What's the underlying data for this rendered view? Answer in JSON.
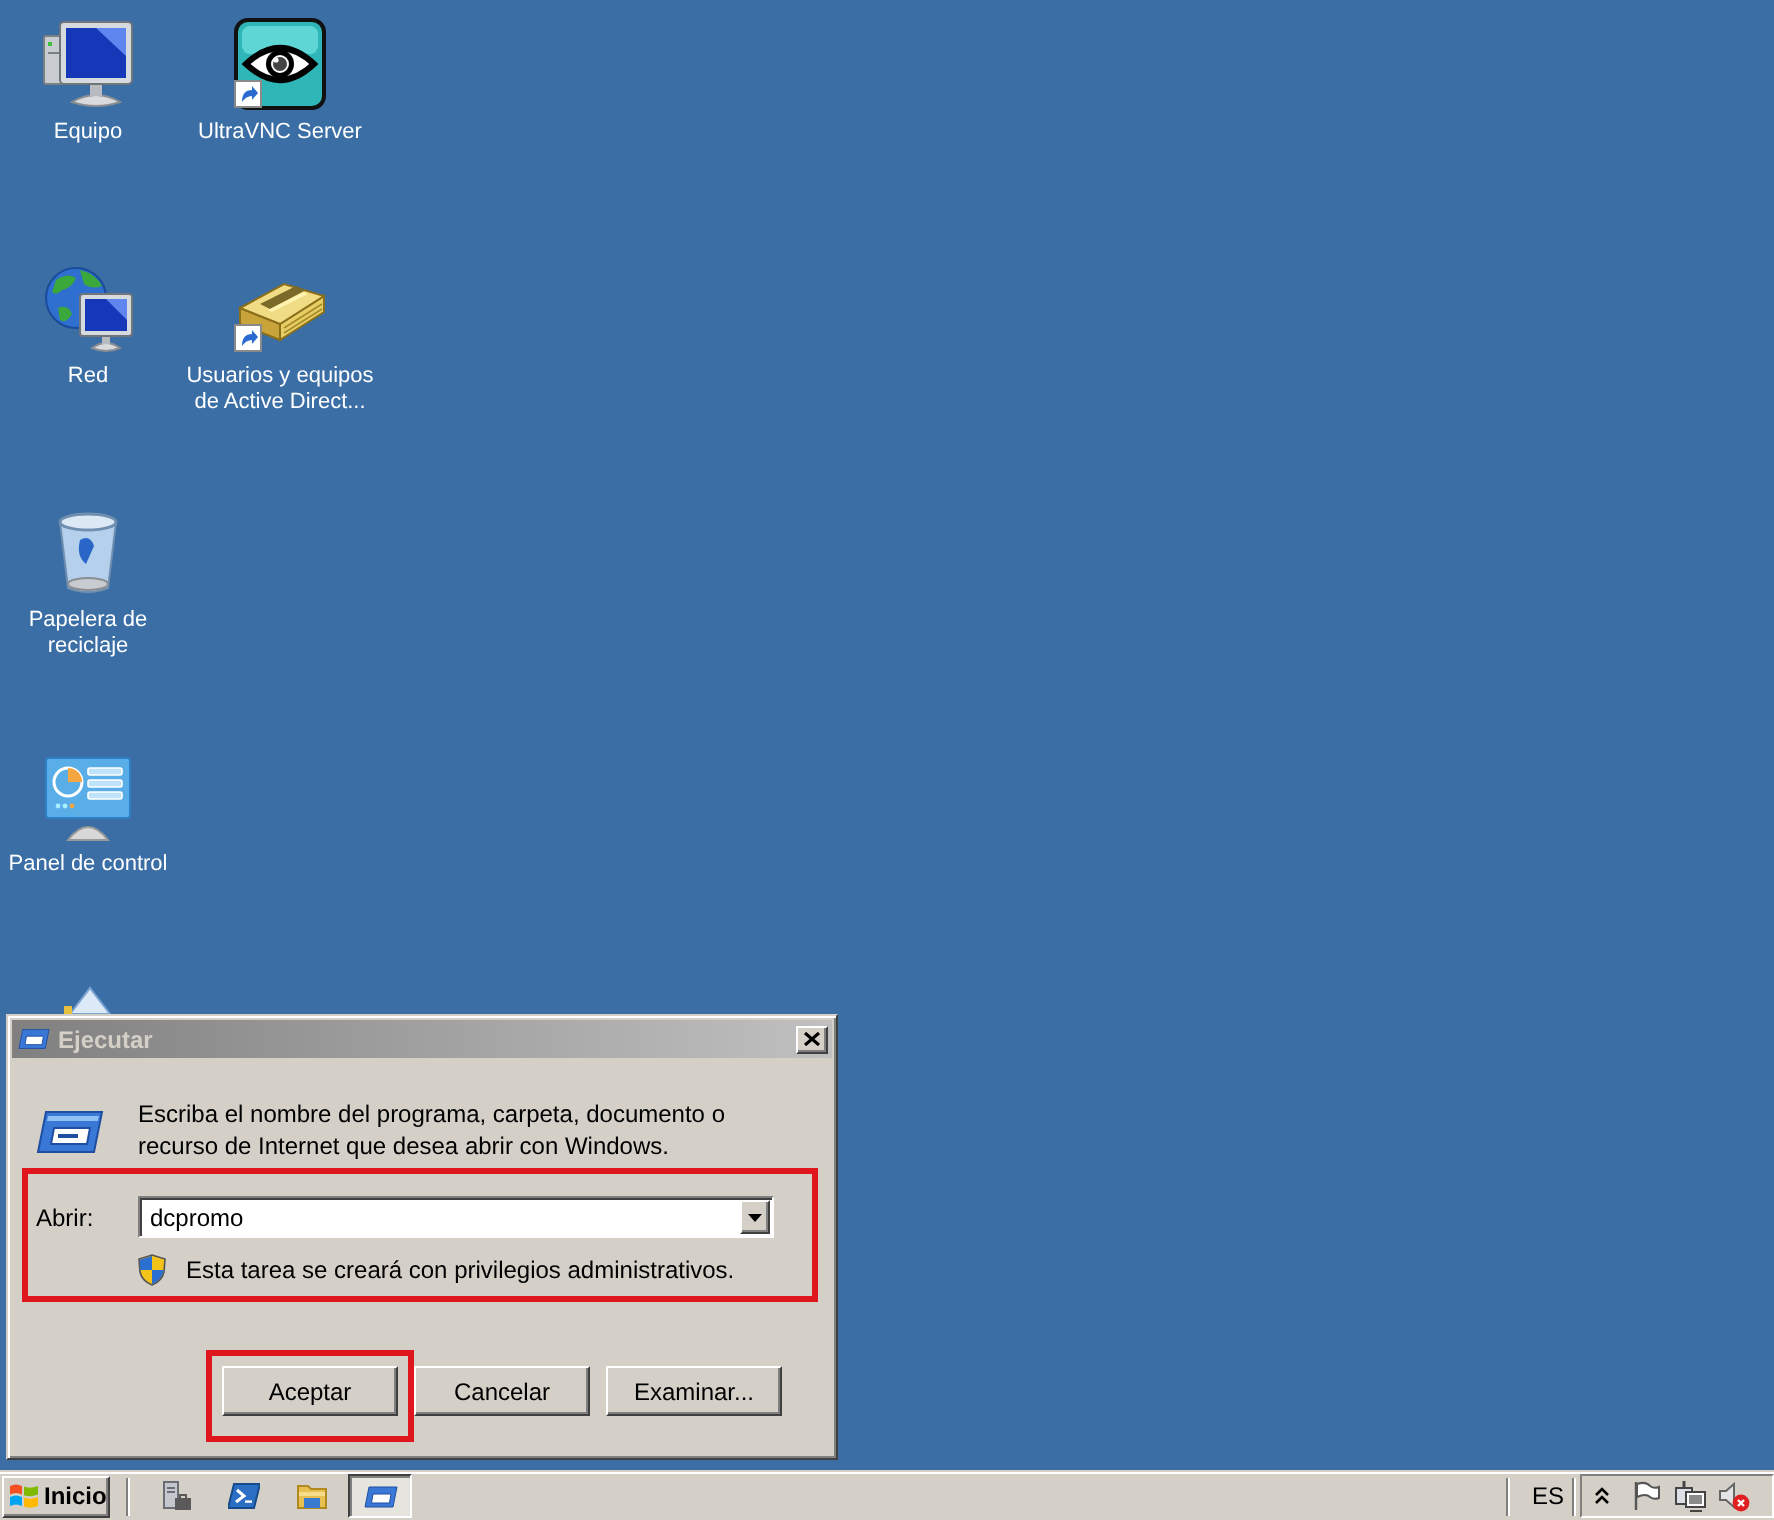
{
  "desktop": {
    "icon_columns": [
      [
        {
          "kind": "computer",
          "label": "Equipo",
          "shortcut": false
        },
        {
          "kind": "network",
          "label": "Red",
          "shortcut": false
        },
        {
          "kind": "recycle-bin",
          "label": "Papelera de reciclaje",
          "shortcut": false
        },
        {
          "kind": "control-panel",
          "label": "Panel de control",
          "shortcut": false
        }
      ],
      [
        {
          "kind": "vnc",
          "label": "UltraVNC Server",
          "shortcut": true
        },
        {
          "kind": "directory",
          "label": "Usuarios y equipos de Active Direct...",
          "shortcut": true
        }
      ]
    ]
  },
  "dialog": {
    "title": "Ejecutar",
    "message": "Escriba el nombre del programa, carpeta, documento o recurso de Internet que desea abrir con Windows.",
    "open_section": {
      "highlighted": true,
      "label": "Abrir:",
      "value": "dcpromo",
      "note": "Esta tarea se creará con privilegios administrativos."
    },
    "buttons": [
      {
        "label": "Aceptar",
        "highlighted": true
      },
      {
        "label": "Cancelar",
        "highlighted": false
      },
      {
        "label": "Examinar...",
        "highlighted": false
      }
    ]
  },
  "taskbar": {
    "start_label": "Inicio",
    "tasks": [
      {
        "selected": true
      }
    ],
    "language": "ES"
  }
}
